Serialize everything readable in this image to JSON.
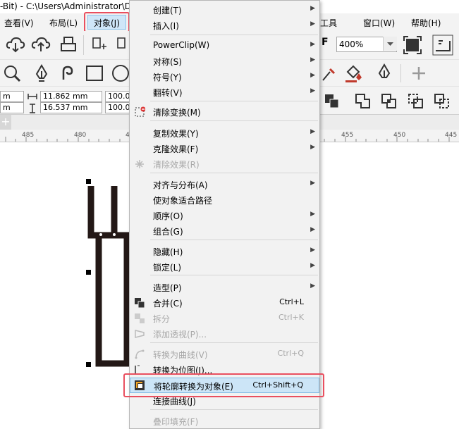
{
  "title": "-Bit) - C:\\Users\\Administrator\\Doc",
  "menubar": {
    "items": [
      "查看(V)",
      "布局(L)",
      "对象(J)",
      "工具",
      "窗口(W)",
      "帮助(H)"
    ]
  },
  "toolbar": {
    "zoom_value": "400%"
  },
  "properties": {
    "width_partial": "m",
    "height_partial": "m",
    "width_value": "11.862 mm",
    "height_value": "16.537 mm",
    "scale_x": "100.0",
    "scale_y": "100.0"
  },
  "ruler": {
    "labels_left": [
      "485",
      "480",
      "475"
    ],
    "labels_right": [
      "455",
      "450",
      "445"
    ],
    "tab_plus": "+"
  },
  "menu": {
    "items": [
      {
        "label": "创建(T)",
        "shortcut": "",
        "submenu": true,
        "disabled": false
      },
      {
        "label": "插入(I)",
        "shortcut": "",
        "submenu": true,
        "disabled": false
      },
      {
        "label": "PowerClip(W)",
        "shortcut": "",
        "submenu": true,
        "disabled": false
      },
      {
        "label": "对称(S)",
        "shortcut": "",
        "submenu": true,
        "disabled": false
      },
      {
        "label": "符号(Y)",
        "shortcut": "",
        "submenu": true,
        "disabled": false
      },
      {
        "label": "翻转(V)",
        "shortcut": "",
        "submenu": true,
        "disabled": false
      },
      {
        "label": "清除变换(M)",
        "shortcut": "",
        "submenu": false,
        "disabled": false
      },
      {
        "label": "复制效果(Y)",
        "shortcut": "",
        "submenu": true,
        "disabled": false
      },
      {
        "label": "克隆效果(F)",
        "shortcut": "",
        "submenu": true,
        "disabled": false
      },
      {
        "label": "清除效果(R)",
        "shortcut": "",
        "submenu": false,
        "disabled": true
      },
      {
        "label": "对齐与分布(A)",
        "shortcut": "",
        "submenu": true,
        "disabled": false
      },
      {
        "label": "使对象适合路径",
        "shortcut": "",
        "submenu": false,
        "disabled": false
      },
      {
        "label": "顺序(O)",
        "shortcut": "",
        "submenu": true,
        "disabled": false
      },
      {
        "label": "组合(G)",
        "shortcut": "",
        "submenu": true,
        "disabled": false
      },
      {
        "label": "隐藏(H)",
        "shortcut": "",
        "submenu": true,
        "disabled": false
      },
      {
        "label": "锁定(L)",
        "shortcut": "",
        "submenu": true,
        "disabled": false
      },
      {
        "label": "造型(P)",
        "shortcut": "",
        "submenu": true,
        "disabled": false
      },
      {
        "label": "合并(C)",
        "shortcut": "Ctrl+L",
        "submenu": false,
        "disabled": false
      },
      {
        "label": "拆分",
        "shortcut": "Ctrl+K",
        "submenu": false,
        "disabled": true
      },
      {
        "label": "添加透视(P)...",
        "shortcut": "",
        "submenu": false,
        "disabled": true
      },
      {
        "label": "转换为曲线(V)",
        "shortcut": "Ctrl+Q",
        "submenu": false,
        "disabled": true
      },
      {
        "label": "转换为位图(J)...",
        "shortcut": "",
        "submenu": false,
        "disabled": false
      },
      {
        "label": "将轮廓转换为对象(E)",
        "shortcut": "Ctrl+Shift+Q",
        "submenu": false,
        "disabled": false,
        "highlighted": true
      },
      {
        "label": "连接曲线(J)",
        "shortcut": "",
        "submenu": false,
        "disabled": false
      },
      {
        "label": "叠印填充(F)",
        "shortcut": "",
        "submenu": false,
        "disabled": true
      }
    ]
  },
  "colors": {
    "accent_highlight": "#cce5f7",
    "callout_red": "#e94f5f",
    "menubar_bg": "#f3f3f3"
  }
}
